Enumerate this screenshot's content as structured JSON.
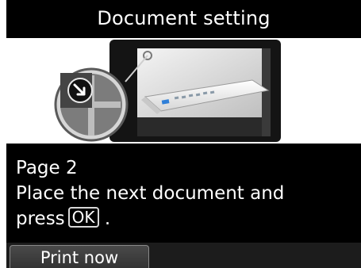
{
  "header": {
    "title": "Document setting"
  },
  "illustration": {
    "icon": "document-placement-illustration"
  },
  "message": {
    "page_label": "Page 2",
    "line1": "Place the next document and",
    "line2_prefix": "press",
    "ok_key": "OK",
    "line2_suffix": "."
  },
  "softkeys": {
    "left_label": "Print now"
  },
  "colors": {
    "screen_bg": "#000000",
    "text": "#ffffff",
    "accent_blue": "#2f7fd8"
  }
}
